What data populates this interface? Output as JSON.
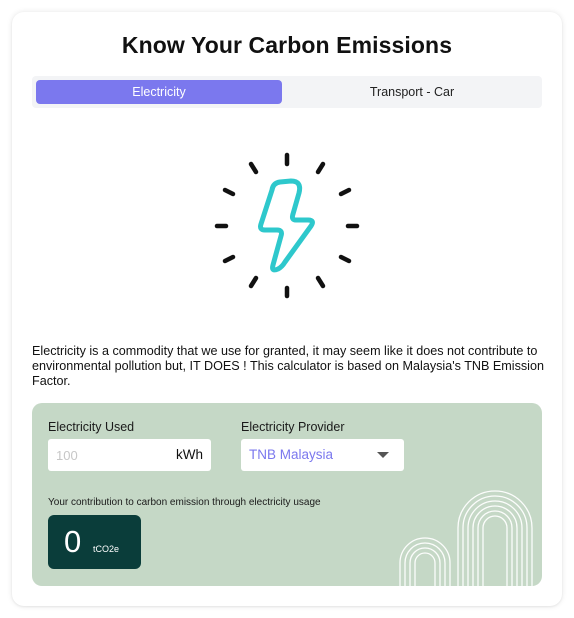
{
  "page": {
    "title": "Know Your Carbon Emissions"
  },
  "tabs": [
    {
      "label": "Electricity",
      "active": true
    },
    {
      "label": "Transport - Car",
      "active": false
    }
  ],
  "hero": {
    "icon": "lightning-bolt-icon",
    "accent_color": "#2ec8cc",
    "ray_color": "#111111"
  },
  "description": "Electricity is a commodity that we use for granted, it may seem like it does not contribute to environmental pollution but, IT DOES ! This calculator is based on Malaysia's TNB Emission Factor.",
  "calculator": {
    "background_color": "#c5d8c6",
    "used_label": "Electricity Used",
    "used_value": "",
    "used_placeholder": "100",
    "used_unit": "kWh",
    "provider_label": "Electricity Provider",
    "provider_value": "TNB Malaysia",
    "contribution_label": "Your contribution to carbon emission through electricity usage",
    "result_value": "0",
    "result_unit": "tCO2e",
    "result_bg_color": "#0a3d3a"
  },
  "colors": {
    "accent": "#7b78ee",
    "tab_bg": "#f3f4f6"
  }
}
